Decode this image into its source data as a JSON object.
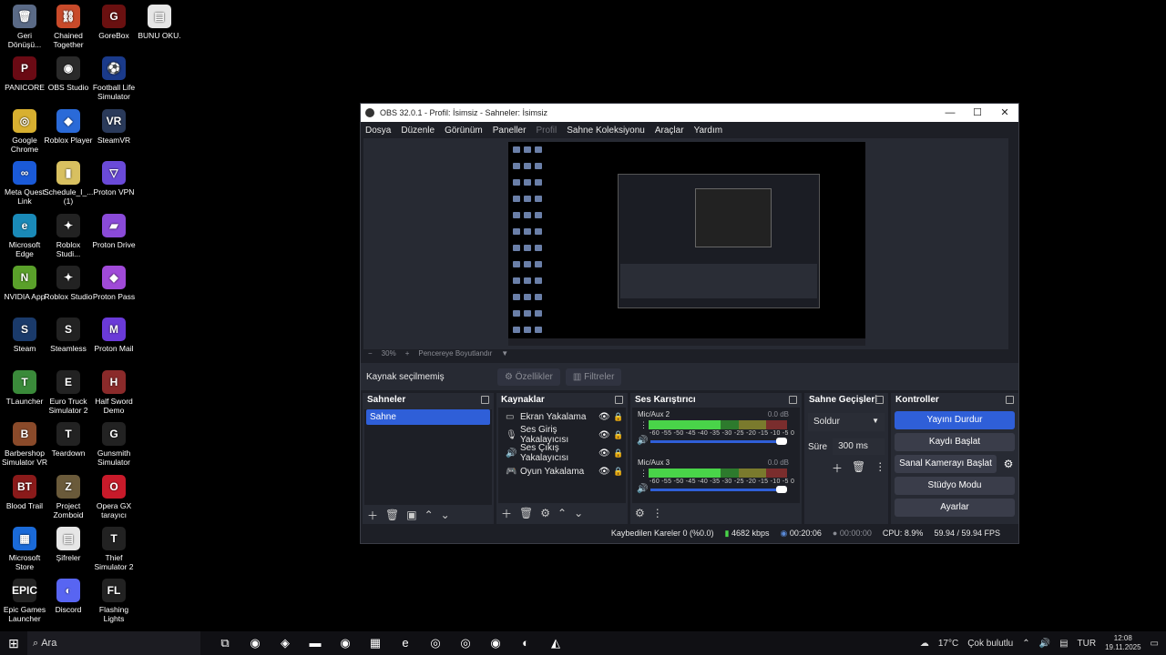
{
  "desktop": {
    "icons": [
      {
        "label": "Geri Dönüşü...",
        "glyph": "🗑",
        "color": "#5a6a86"
      },
      {
        "label": "Chained Together",
        "glyph": "⛓",
        "color": "#c84a2a"
      },
      {
        "label": "GoreBox",
        "glyph": "G",
        "color": "#6a1010"
      },
      {
        "label": "BUNU OKU.",
        "glyph": "▤",
        "color": "#e6e6e6"
      },
      {
        "label": "PANICORE",
        "glyph": "P",
        "color": "#6a0a14"
      },
      {
        "label": "OBS Studio",
        "glyph": "◉",
        "color": "#2a2a2a"
      },
      {
        "label": "Football Life Simulator",
        "glyph": "⚽",
        "color": "#1a3a8a"
      },
      {
        "label": "Google Chrome",
        "glyph": "◎",
        "color": "#d8b030"
      },
      {
        "label": "Roblox Player",
        "glyph": "◆",
        "color": "#2a6ad8"
      },
      {
        "label": "SteamVR",
        "glyph": "VR",
        "color": "#2a3a5a"
      },
      {
        "label": "Meta Quest Link",
        "glyph": "∞",
        "color": "#1a5ad8"
      },
      {
        "label": "Schedule_I_... (1)",
        "glyph": "▮",
        "color": "#d8c060"
      },
      {
        "label": "Proton VPN",
        "glyph": "▽",
        "color": "#6a4ad8"
      },
      {
        "label": "Microsoft Edge",
        "glyph": "e",
        "color": "#1a8ab8"
      },
      {
        "label": "Roblox Studi...",
        "glyph": "✦",
        "color": "#222"
      },
      {
        "label": "Proton Drive",
        "glyph": "▰",
        "color": "#8a4ad8"
      },
      {
        "label": "NVIDIA App",
        "glyph": "N",
        "color": "#5aa02a"
      },
      {
        "label": "Roblox Studio",
        "glyph": "✦",
        "color": "#222"
      },
      {
        "label": "Proton Pass",
        "glyph": "◆",
        "color": "#a04ad8"
      },
      {
        "label": "Steam",
        "glyph": "S",
        "color": "#1a3a6a"
      },
      {
        "label": "Steamless",
        "glyph": "S",
        "color": "#222"
      },
      {
        "label": "Proton Mail",
        "glyph": "M",
        "color": "#6a3ad8"
      },
      {
        "label": "TLauncher",
        "glyph": "T",
        "color": "#3a8a3a"
      },
      {
        "label": "Euro Truck Simulator 2",
        "glyph": "E",
        "color": "#222"
      },
      {
        "label": "Half Sword Demo",
        "glyph": "H",
        "color": "#8a2a2a"
      },
      {
        "label": "Barbershop Simulator VR",
        "glyph": "B",
        "color": "#8a4a2a"
      },
      {
        "label": "Teardown",
        "glyph": "T",
        "color": "#222"
      },
      {
        "label": "Gunsmith Simulator",
        "glyph": "G",
        "color": "#222"
      },
      {
        "label": "Blood Trail",
        "glyph": "BT",
        "color": "#8a1a1a"
      },
      {
        "label": "Project Zomboid",
        "glyph": "Z",
        "color": "#6a5a3a"
      },
      {
        "label": "Opera GX tarayıcı",
        "glyph": "O",
        "color": "#c81a2a"
      },
      {
        "label": "Microsoft Store",
        "glyph": "▦",
        "color": "#1a6ad8"
      },
      {
        "label": "Şifreler",
        "glyph": "▤",
        "color": "#e6e6e6"
      },
      {
        "label": "Thief Simulator 2",
        "glyph": "T",
        "color": "#222"
      },
      {
        "label": "Epic Games Launcher",
        "glyph": "EPIC",
        "color": "#222"
      },
      {
        "label": "Discord",
        "glyph": "◐",
        "color": "#5865f2"
      },
      {
        "label": "Flashing Lights",
        "glyph": "FL",
        "color": "#222"
      }
    ]
  },
  "window": {
    "title": "OBS 32.0.1 - Profil: İsimsiz - Sahneler: İsimsiz",
    "controls": {
      "min": "—",
      "max": "☐",
      "close": "✕"
    },
    "menu": [
      {
        "label": "Dosya",
        "disabled": false
      },
      {
        "label": "Düzenle",
        "disabled": false
      },
      {
        "label": "Görünüm",
        "disabled": false
      },
      {
        "label": "Paneller",
        "disabled": false
      },
      {
        "label": "Profil",
        "disabled": true
      },
      {
        "label": "Sahne Koleksiyonu",
        "disabled": false
      },
      {
        "label": "Araçlar",
        "disabled": false
      },
      {
        "label": "Yardım",
        "disabled": false
      }
    ],
    "zoom": {
      "minus": "−",
      "value": "30%",
      "plus": "+",
      "fit": "Pencereye Boyutlandır",
      "arrow": "▼"
    },
    "source_bar": {
      "label": "Kaynak seçilmemiş",
      "properties": "Özellikler",
      "filters": "Filtreler"
    },
    "scenes": {
      "title": "Sahneler",
      "items": [
        "Sahne"
      ]
    },
    "sources": {
      "title": "Kaynaklar",
      "items": [
        {
          "name": "Ekran Yakalama",
          "icon": "▭"
        },
        {
          "name": "Ses Giriş Yakalayıcısı",
          "icon": "🎙"
        },
        {
          "name": "Ses Çıkış Yakalayıcısı",
          "icon": "🔊"
        },
        {
          "name": "Oyun Yakalama",
          "icon": "🎮"
        }
      ]
    },
    "mixer": {
      "title": "Ses Karıştırıcı",
      "channels": [
        {
          "name": "Mic/Aux 2",
          "db": "0.0 dB",
          "level": 0.52
        },
        {
          "name": "Mic/Aux 3",
          "db": "0.0 dB",
          "level": 0.52
        }
      ],
      "scale": "-60 -55 -50 -45 -40 -35 -30 -25 -20 -15 -10 -5 0"
    },
    "transitions": {
      "title": "Sahne Geçişleri",
      "selected": "Soldur",
      "duration_label": "Süre",
      "duration_value": "300 ms"
    },
    "controls_dock": {
      "title": "Kontroller",
      "stop_stream": "Yayını Durdur",
      "start_record": "Kaydı Başlat",
      "virtual_cam": "Sanal Kamerayı Başlat",
      "studio_mode": "Stüdyo Modu",
      "settings": "Ayarlar"
    },
    "status": {
      "dropped": "Kaybedilen Kareler 0 (%0.0)",
      "bitrate": "4682 kbps",
      "stream_time": "00:20:06",
      "record_time": "00:00:00",
      "cpu": "CPU: 8.9%",
      "fps": "59.94 / 59.94 FPS"
    }
  },
  "taskbar": {
    "search_placeholder": "Ara",
    "weather": "17°C",
    "weather_text": "Çok bulutlu",
    "lang": "TUR",
    "time": "12:08",
    "date": "19.11.2025"
  }
}
